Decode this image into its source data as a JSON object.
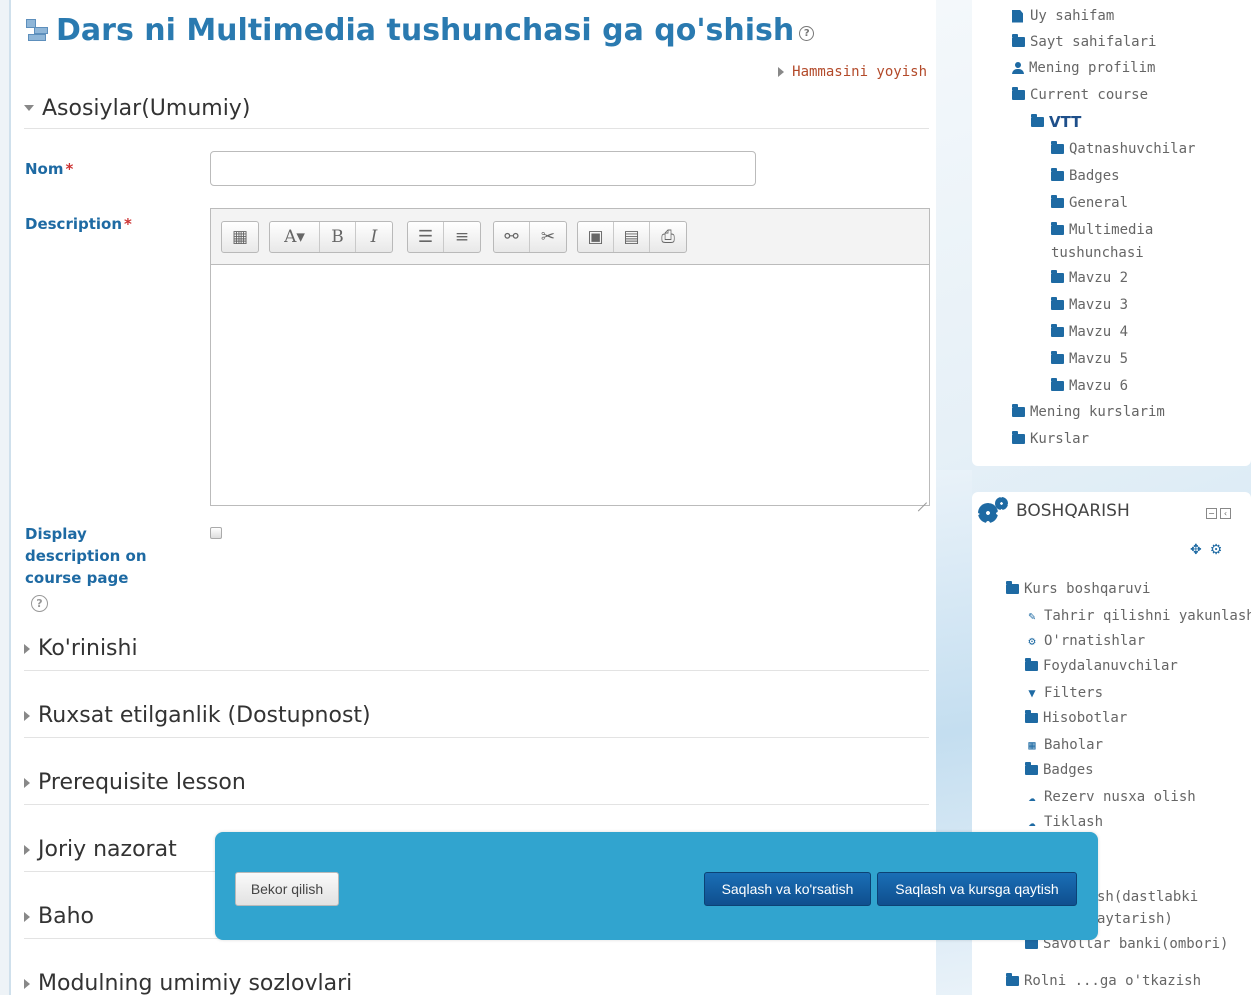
{
  "page": {
    "title": "Dars ni Multimedia tushunchasi ga qo'shish",
    "help_glyph": "?",
    "expand_all": "Hammasini yoyish"
  },
  "form": {
    "section_general": "Asosiylar(Umumiy)",
    "name_label": "Nom",
    "description_label": "Description",
    "required_mark": "*",
    "display_description_label": "Display description on course page",
    "display_description_checked": false,
    "name_value": "",
    "description_value": "",
    "help_glyph": "?",
    "collapsed_sections": [
      {
        "label": "Ko'rinishi"
      },
      {
        "label": "Ruxsat etilganlik (Dostupnost)"
      },
      {
        "label": "Prerequisite lesson"
      },
      {
        "label": "Joriy nazorat"
      },
      {
        "label": "Baho"
      },
      {
        "label": "Modulning umimiy sozlovlari"
      }
    ]
  },
  "editor_toolbar": {
    "groups": [
      {
        "buttons": [
          {
            "icon": "toolbar-toggle-icon",
            "glyph": "▦"
          }
        ]
      },
      {
        "buttons": [
          {
            "icon": "font-style-icon",
            "glyph": "A▾"
          },
          {
            "icon": "bold-icon",
            "glyph": "B"
          },
          {
            "icon": "italic-icon",
            "glyph": "I"
          }
        ]
      },
      {
        "buttons": [
          {
            "icon": "unordered-list-icon",
            "glyph": "☰"
          },
          {
            "icon": "ordered-list-icon",
            "glyph": "≡"
          }
        ]
      },
      {
        "buttons": [
          {
            "icon": "link-icon",
            "glyph": "⚯"
          },
          {
            "icon": "unlink-icon",
            "glyph": "✂"
          }
        ]
      },
      {
        "buttons": [
          {
            "icon": "image-icon",
            "glyph": "▣"
          },
          {
            "icon": "media-icon",
            "glyph": "▤"
          },
          {
            "icon": "manage-files-icon",
            "glyph": "⎙"
          }
        ]
      }
    ]
  },
  "navigation": {
    "items": [
      {
        "label": "Uy sahifam",
        "icon": "doc-icon"
      },
      {
        "label": "Sayt sahifalari",
        "icon": "folder-icon"
      },
      {
        "label": "Mening profilim",
        "icon": "user-icon"
      },
      {
        "label": "Current course",
        "icon": "folder-open-icon"
      },
      {
        "label": "VTT",
        "icon": "folder-open-icon"
      },
      {
        "label": "Qatnashuvchilar",
        "icon": "folder-icon"
      },
      {
        "label": "Badges",
        "icon": "folder-icon"
      },
      {
        "label": "General",
        "icon": "folder-icon"
      },
      {
        "label": "Multimedia",
        "icon": "folder-icon"
      },
      {
        "label": "tushunchasi",
        "icon": ""
      },
      {
        "label": "Mavzu 2",
        "icon": "folder-icon"
      },
      {
        "label": "Mavzu 3",
        "icon": "folder-icon"
      },
      {
        "label": "Mavzu 4",
        "icon": "folder-icon"
      },
      {
        "label": "Mavzu 5",
        "icon": "folder-icon"
      },
      {
        "label": "Mavzu 6",
        "icon": "folder-icon"
      },
      {
        "label": "Mening kurslarim",
        "icon": "folder-icon"
      },
      {
        "label": "Kurslar",
        "icon": "folder-icon"
      }
    ]
  },
  "administration": {
    "title": "BOSHQARISH",
    "items": [
      {
        "label": "Kurs boshqaruvi",
        "icon": "folder-open-icon"
      },
      {
        "label": "Tahrir qilishni yakunlash",
        "icon": "pencil-icon"
      },
      {
        "label": "O'rnatishlar",
        "icon": "gear-icon"
      },
      {
        "label": "Foydalanuvchilar",
        "icon": "folder-icon"
      },
      {
        "label": "Filters",
        "icon": "filter-icon"
      },
      {
        "label": "Hisobotlar",
        "icon": "folder-icon"
      },
      {
        "label": "Baholar",
        "icon": "table-icon"
      },
      {
        "label": "Badges",
        "icon": "folder-icon"
      },
      {
        "label": "Rezerv nusxa olish",
        "icon": "cloud-icon"
      },
      {
        "label": "Tiklash",
        "icon": "cloud-icon"
      },
      {
        "label": "sh(dastlabki",
        "icon": ""
      },
      {
        "label": "aytarish)",
        "icon": ""
      },
      {
        "label": "Savollar banki(ombori)",
        "icon": "folder-icon"
      },
      {
        "label": "Rolni ...ga o'tkazish",
        "icon": "folder-icon"
      }
    ]
  },
  "actions": {
    "cancel": "Bekor qilish",
    "save_and_display": "Saqlash va ko'rsatish",
    "save_and_return": "Saqlash va kursga qaytish"
  },
  "colors": {
    "title_blue": "#2a7ab0",
    "label_blue": "#1e6aa3",
    "link_red": "#b34a2a",
    "action_bar": "#31a4cf",
    "primary_button": "#135f9f"
  }
}
